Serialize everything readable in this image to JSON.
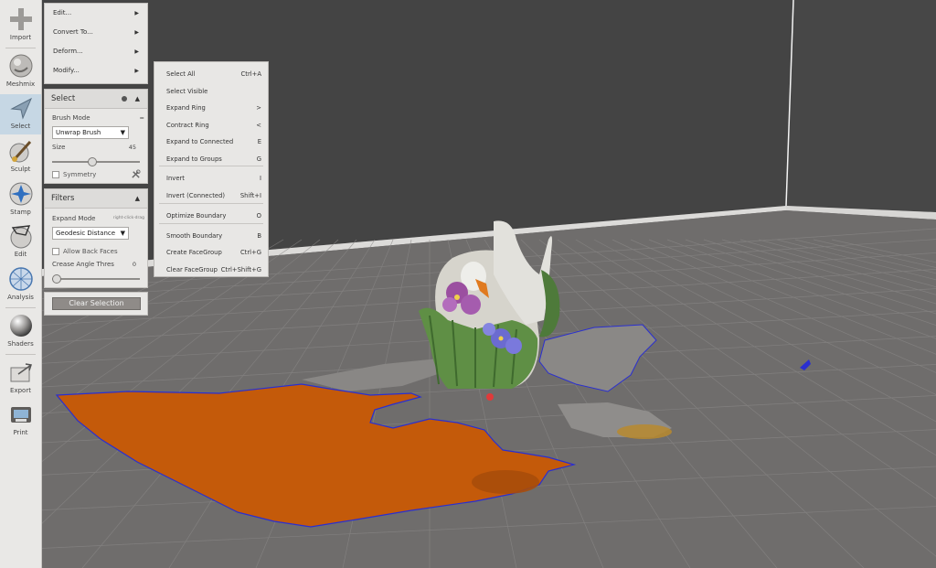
{
  "toolbar": {
    "items": [
      {
        "label": "Import",
        "icon": "plus-icon"
      },
      {
        "label": "Meshmix",
        "icon": "meshmix-icon"
      },
      {
        "label": "Select",
        "icon": "select-arrow-icon"
      },
      {
        "label": "Sculpt",
        "icon": "brush-icon"
      },
      {
        "label": "Stamp",
        "icon": "stamp-icon"
      },
      {
        "label": "Edit",
        "icon": "edit-icon"
      },
      {
        "label": "Analysis",
        "icon": "analysis-icon"
      },
      {
        "label": "Shaders",
        "icon": "shader-sphere-icon"
      },
      {
        "label": "Export",
        "icon": "export-icon"
      },
      {
        "label": "Print",
        "icon": "printer-icon"
      }
    ]
  },
  "edit_menu": {
    "items": [
      "Edit...",
      "Convert To...",
      "Deform...",
      "Modify..."
    ]
  },
  "select_panel": {
    "title": "Select",
    "brush_mode_label": "Brush Mode",
    "brush_mode_value": "Unwrap Brush",
    "size_label": "Size",
    "size_value": "45",
    "size_fraction": 0.45,
    "symmetry_label": "Symmetry"
  },
  "filters_panel": {
    "title": "Filters",
    "expand_mode_label": "Expand Mode",
    "expand_mode_hint": "right-click-drag",
    "expand_mode_value": "Geodesic Distance",
    "allow_back_faces_label": "Allow Back Faces",
    "crease_angle_label": "Crease Angle Thres",
    "crease_angle_value": "0",
    "crease_angle_fraction": 0.0
  },
  "clear_selection_label": "Clear Selection",
  "modify_submenu": {
    "items": [
      {
        "label": "Select All",
        "shortcut": "Ctrl+A"
      },
      {
        "label": "Select Visible",
        "shortcut": ""
      },
      {
        "label": "Expand Ring",
        "shortcut": ">"
      },
      {
        "label": "Contract Ring",
        "shortcut": "<"
      },
      {
        "label": "Expand to Connected",
        "shortcut": "E"
      },
      {
        "label": "Expand to Groups",
        "shortcut": "G"
      },
      {
        "label": "Invert",
        "shortcut": "I"
      },
      {
        "label": "Invert (Connected)",
        "shortcut": "Shift+I"
      },
      {
        "label": "Optimize Boundary",
        "shortcut": "O"
      },
      {
        "label": "Smooth Boundary",
        "shortcut": "B"
      },
      {
        "label": "Create FaceGroup",
        "shortcut": "Ctrl+G"
      },
      {
        "label": "Clear FaceGroup",
        "shortcut": "Ctrl+Shift+G"
      }
    ]
  },
  "colors": {
    "background_wall": "#454545",
    "floor": "#6e6c6b",
    "selection": "#c45a0a",
    "boundary": "#2a2fd0",
    "active_tool": "#c6d7e4"
  }
}
